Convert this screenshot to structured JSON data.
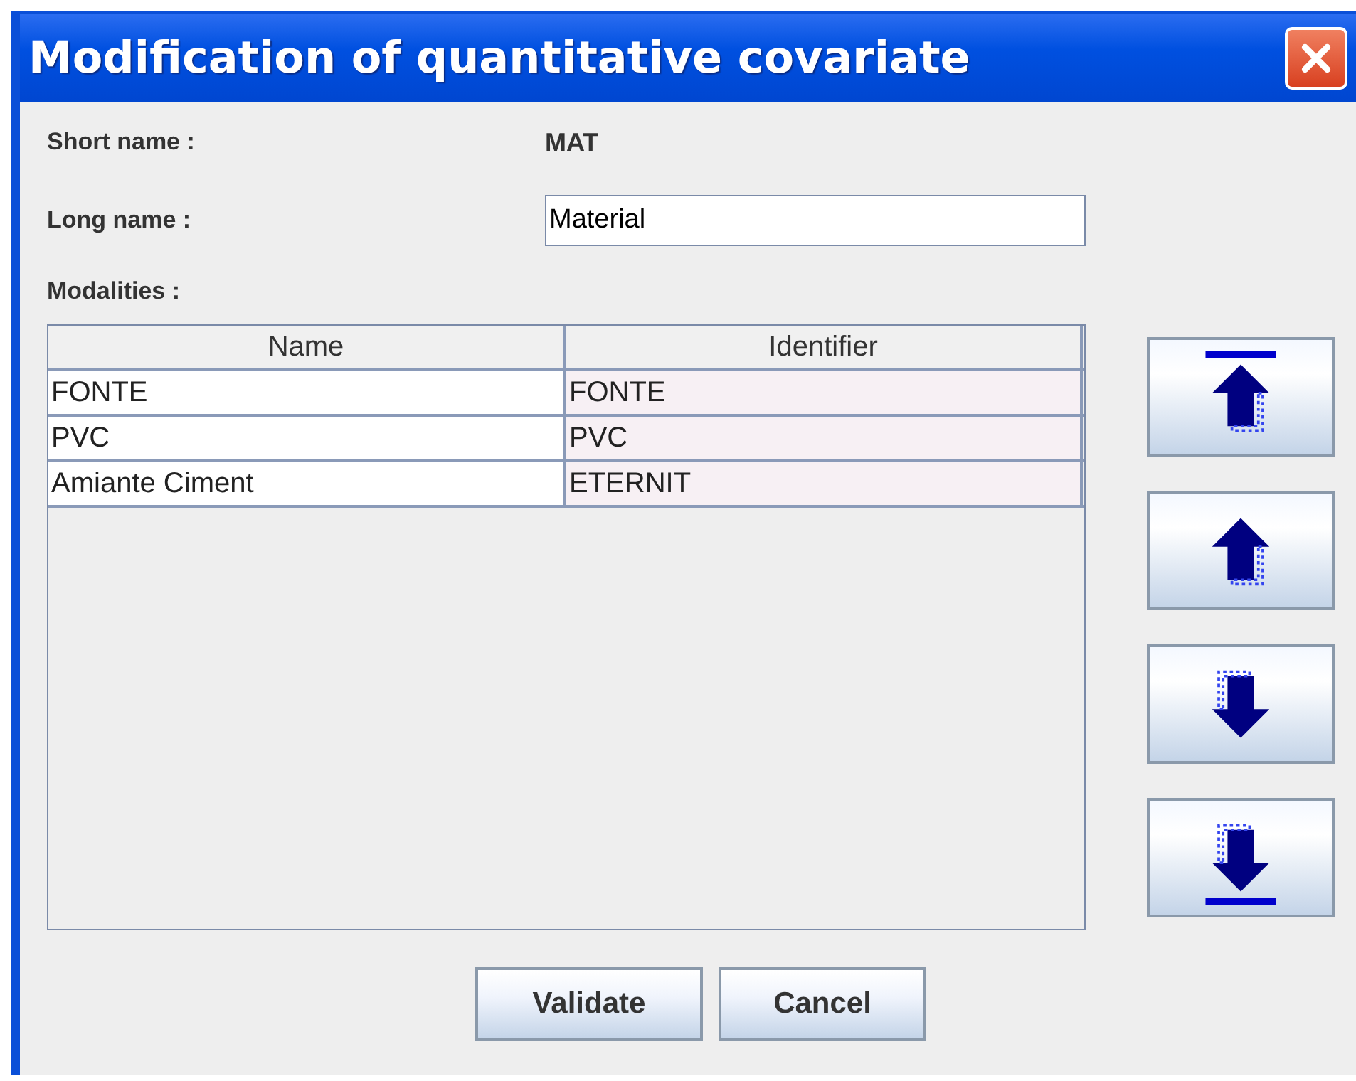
{
  "window": {
    "title": "Modification of quantitative covariate"
  },
  "short_name": {
    "label": "Short name :",
    "value": "MAT"
  },
  "long_name": {
    "label": "Long name :",
    "value": "Material"
  },
  "modalities": {
    "label": "Modalities :",
    "columns": [
      "Name",
      "Identifier"
    ],
    "rows": [
      [
        "FONTE",
        "FONTE"
      ],
      [
        "PVC",
        "PVC"
      ],
      [
        "Amiante Ciment",
        "ETERNIT"
      ]
    ]
  },
  "move_buttons": [
    {
      "kind": "top"
    },
    {
      "kind": "up"
    },
    {
      "kind": "down"
    },
    {
      "kind": "bottom"
    }
  ],
  "buttons": [
    "Validate",
    "Cancel"
  ]
}
